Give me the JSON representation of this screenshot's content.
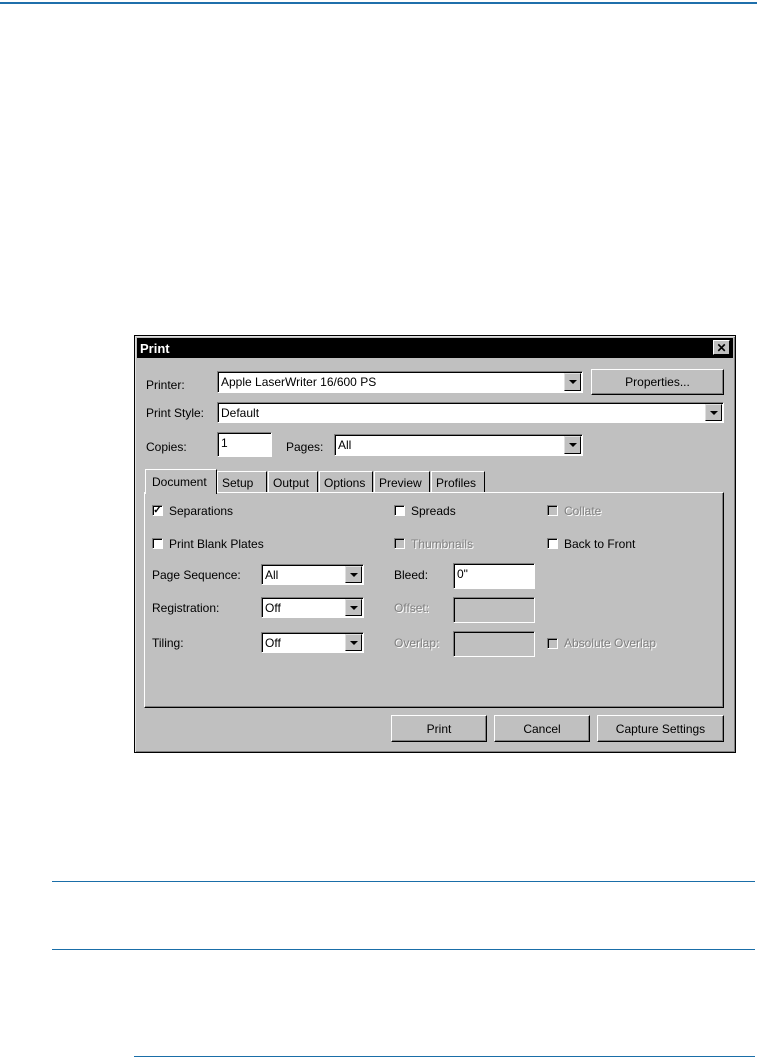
{
  "dialog": {
    "title": "Print",
    "close_glyph": "✕"
  },
  "printer": {
    "label": "Printer:",
    "value": "Apple LaserWriter 16/600 PS",
    "properties_button": "Properties..."
  },
  "print_style": {
    "label": "Print Style:",
    "value": "Default"
  },
  "copies": {
    "label": "Copies:",
    "value": "1"
  },
  "pages": {
    "label": "Pages:",
    "value": "All"
  },
  "tabs": [
    {
      "label": "Document",
      "active": true
    },
    {
      "label": "Setup",
      "active": false
    },
    {
      "label": "Output",
      "active": false
    },
    {
      "label": "Options",
      "active": false
    },
    {
      "label": "Preview",
      "active": false
    },
    {
      "label": "Profiles",
      "active": false
    }
  ],
  "document_tab": {
    "separations": {
      "label": "Separations",
      "checked": true
    },
    "spreads": {
      "label": "Spreads",
      "checked": false
    },
    "collate": {
      "label": "Collate",
      "checked": false,
      "enabled": false
    },
    "print_blank_plates": {
      "label": "Print Blank Plates",
      "checked": false
    },
    "thumbnails": {
      "label": "Thumbnails",
      "checked": false,
      "enabled": false
    },
    "back_to_front": {
      "label": "Back to Front",
      "checked": false
    },
    "page_sequence": {
      "label": "Page Sequence:",
      "value": "All"
    },
    "bleed": {
      "label": "Bleed:",
      "value": "0\""
    },
    "registration": {
      "label": "Registration:",
      "value": "Off"
    },
    "offset": {
      "label": "Offset:",
      "value": "",
      "enabled": false
    },
    "tiling": {
      "label": "Tiling:",
      "value": "Off"
    },
    "overlap": {
      "label": "Overlap:",
      "value": "",
      "enabled": false
    },
    "absolute_overlap": {
      "label": "Absolute Overlap",
      "checked": false,
      "enabled": false
    }
  },
  "buttons": {
    "print": "Print",
    "cancel": "Cancel",
    "capture": "Capture Settings"
  },
  "check_glyph": "✓"
}
